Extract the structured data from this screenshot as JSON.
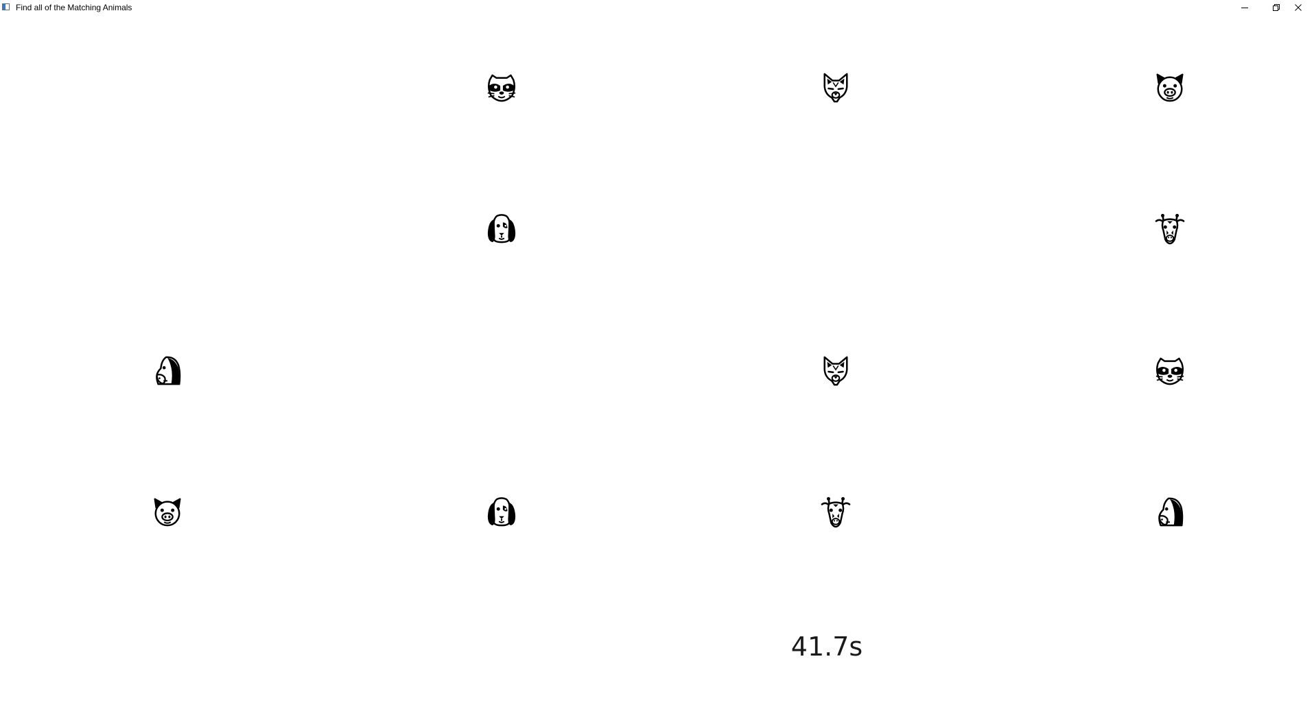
{
  "window": {
    "title": "Find all of the Matching Animals",
    "icon": "app-window-icon"
  },
  "controls": {
    "minimize": "minimize-icon",
    "restore": "restore-icon",
    "close": "close-icon"
  },
  "board": {
    "rows": 4,
    "cols": 4,
    "cells": [
      [
        "",
        "raccoon",
        "wolf",
        "pig"
      ],
      [
        "",
        "dog",
        "",
        "giraffe"
      ],
      [
        "horse",
        "",
        "wolf",
        "raccoon"
      ],
      [
        "pig",
        "dog",
        "giraffe",
        "horse"
      ]
    ]
  },
  "timer": {
    "value": "41.7s"
  }
}
